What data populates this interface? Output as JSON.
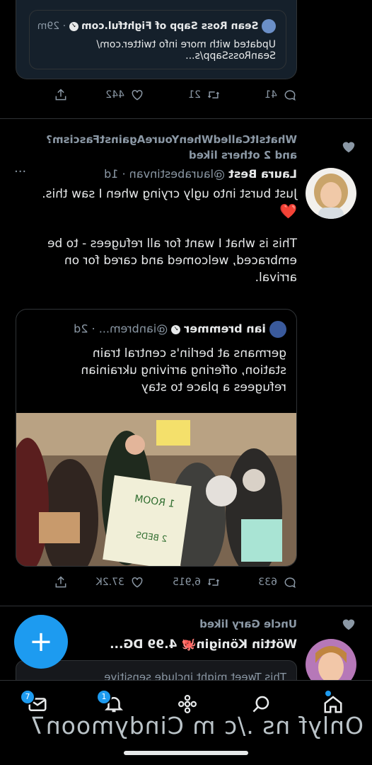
{
  "tweet0": {
    "card_author": "Sean Ross Sapp of Fightful.com",
    "card_time": "· 29m",
    "card_text_1": "Updated with more info twitter.com/",
    "card_text_2": "SeanRossSapp/s...",
    "replies": "41",
    "retweets": "21",
    "likes": "442"
  },
  "tweet1": {
    "social_context_1": "WhatsItCalledWhenYoureAgainstFascism?",
    "social_context_2": "and 2 others liked",
    "author_name": "Laura Best",
    "author_handle": "@laurabestinvan · 1d",
    "more": "···",
    "text_1": "Just burst into ugly crying when I saw this.",
    "heart_emoji": "❤️",
    "text_2": "This is what I want for all refugees - to be",
    "text_3": "embraced, welcomed and cared for on",
    "text_4": "arrival.",
    "quote": {
      "author_name": "ian bremmer",
      "author_handle": "@ianbrem... · 2d",
      "text_1": "germans at berlin's central train",
      "text_2": "station, offering arriving ukrainian",
      "text_3": "refugees a place to stay",
      "sign_text_1": "1 ROOM",
      "sign_text_2": "2 BEDS"
    },
    "replies": "633",
    "retweets": "6,915",
    "likes": "37.2K"
  },
  "tweet2": {
    "social_context": "Uncle Gary liked",
    "author_name": "Wöttin Königin🐙 4.99 DG...",
    "sensitive_notice": "This Tweet might include sensitive"
  },
  "tabbar": {
    "notifications_badge": "1",
    "messages_badge": "7"
  },
  "watermark": "Onlyf ns ./c m Cindymoon7",
  "colors": {
    "accent": "#1d9bf0",
    "background": "#000000",
    "muted": "#8b98a5"
  }
}
